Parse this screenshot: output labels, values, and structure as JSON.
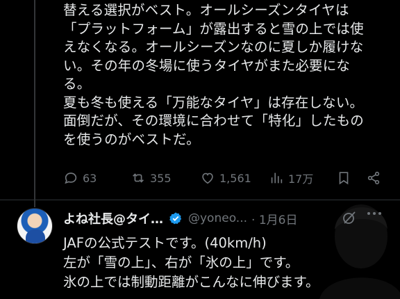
{
  "tweet": {
    "lines": [
      "替える選択がベスト。オールシーズンタイヤは",
      "「プラットフォーム」が露出すると雪の上では使",
      "えなくなる。オールシーズンなのに夏しか履けな",
      "い。その年の冬場に使うタイヤがまた必要にな",
      "る。",
      "夏も冬も使える「万能なタイヤ」は存在しない。",
      "面倒だが、その環境に合わせて「特化」したもの",
      "を使うのがベストだ。"
    ],
    "actions": {
      "replies": "63",
      "reposts": "355",
      "likes": "1,561",
      "views": "17万"
    }
  },
  "reply": {
    "name": "よね社長@タイ…",
    "handle": "@yoneo...",
    "date": "· 1月6日",
    "lines": [
      "JAFの公式テストです。(40km/h)",
      "左が「雪の上」、右が「氷の上」です。",
      "氷の上では制動距離がこんなに伸びます。"
    ]
  },
  "colors": {
    "background": "#000000",
    "text": "#e7e9ea",
    "muted": "#71767b",
    "verified": "#1d9bf0"
  }
}
